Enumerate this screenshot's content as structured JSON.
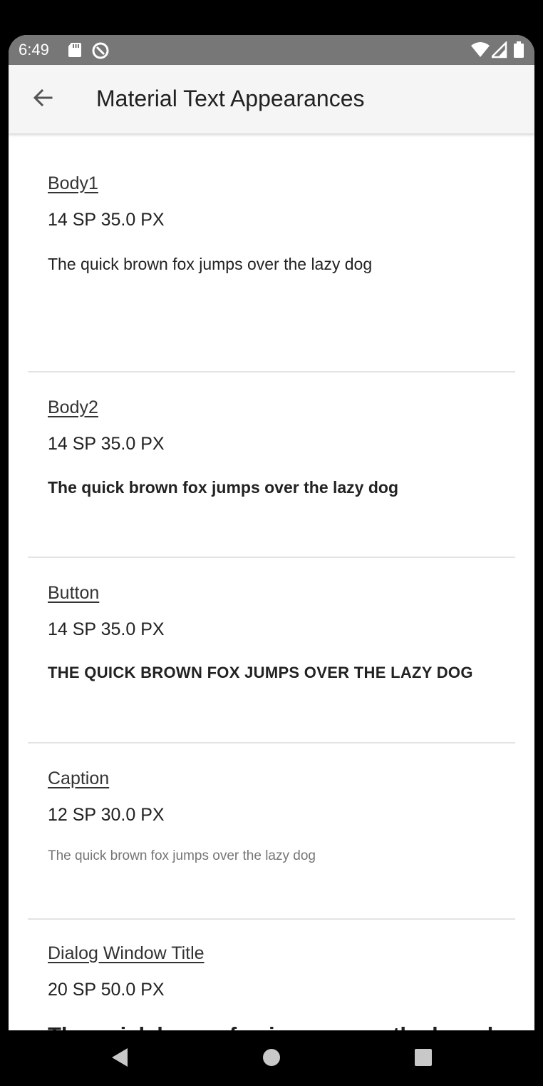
{
  "status_bar": {
    "time": "6:49"
  },
  "app_bar": {
    "title": "Material Text Appearances"
  },
  "items": [
    {
      "name": "Body1",
      "size": "14 SP  35.0 PX",
      "sample": "The quick brown fox jumps over the lazy dog"
    },
    {
      "name": "Body2",
      "size": "14 SP  35.0 PX",
      "sample": "The quick brown fox jumps over the lazy dog"
    },
    {
      "name": "Button",
      "size": "14 SP  35.0 PX",
      "sample": "THE QUICK BROWN FOX JUMPS OVER THE LAZY DOG"
    },
    {
      "name": "Caption",
      "size": "12 SP  30.0 PX",
      "sample": "The quick brown fox jumps over the lazy dog"
    },
    {
      "name": "Dialog Window Title",
      "size": "20 SP  50.0 PX",
      "sample": "The quick brown fox jumps over the lazy dog"
    }
  ],
  "icons": {
    "back": "arrow-back-icon",
    "sd_card": "sd-card-icon",
    "data_saver": "data-saver-icon",
    "wifi": "wifi-icon",
    "signal": "signal-icon",
    "battery": "battery-icon",
    "nav_back": "nav-back-icon",
    "nav_home": "nav-home-icon",
    "nav_recents": "nav-recents-icon"
  },
  "colors": {
    "status_bar": "#777777",
    "app_bar": "#f5f5f5",
    "background": "#ffffff"
  }
}
